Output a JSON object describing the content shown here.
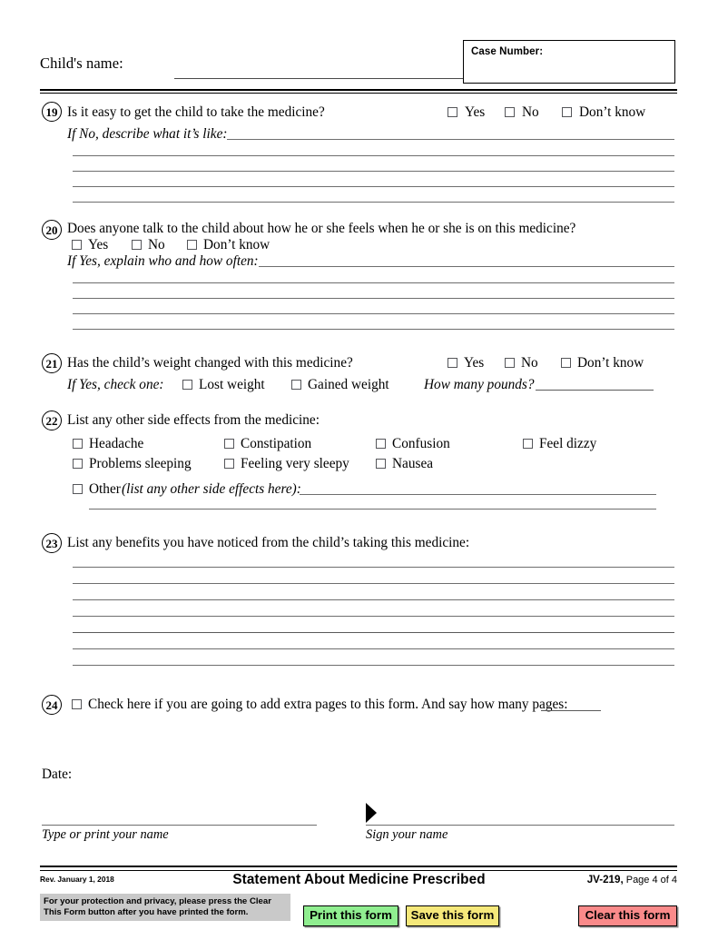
{
  "header": {
    "child_name_label": "Child's name:",
    "case_number_label": "Case Number:",
    "case_number_value": ""
  },
  "questions": [
    {
      "number": "19",
      "prompt": "Is it easy to get the child to take the medicine?",
      "options": [
        "Yes",
        "No",
        "Don’t know"
      ],
      "followup": "If No, describe what it’s like:",
      "write_lines": 4
    },
    {
      "number": "20",
      "prompt": "Does anyone talk to the child about how he or she feels when he or she is on this medicine?",
      "options": [
        "Yes",
        "No",
        "Don’t know"
      ],
      "followup": "If Yes, explain who and how often:",
      "write_lines": 4
    },
    {
      "number": "21",
      "prompt": "Has the child’s weight changed with this medicine?",
      "options": [
        "Yes",
        "No",
        "Don’t know"
      ],
      "followup": "If Yes, check one:",
      "weight_options": [
        "Lost weight",
        "Gained weight"
      ],
      "pounds_label": "How many pounds?",
      "pounds_value": ""
    },
    {
      "number": "22",
      "prompt": "List any other side effects from the medicine:",
      "side_effects_row1": [
        "Headache",
        "Constipation",
        "Confusion",
        "Feel dizzy"
      ],
      "side_effects_row2": [
        "Problems sleeping",
        "Feeling very sleepy",
        "Nausea"
      ],
      "other_label": "Other",
      "other_hint": "(list any other side effects here):",
      "other_value": "",
      "write_lines": 2
    },
    {
      "number": "23",
      "prompt": "List any benefits you have noticed from the child’s taking this medicine:",
      "write_lines": 7
    },
    {
      "number": "24",
      "prompt": "Check here if you are going to add extra pages to this form. And say how many pages:",
      "pages_value": ""
    }
  ],
  "signature": {
    "date_label": "Date:",
    "date_value": "",
    "print_name_caption": "Type or print your name",
    "sign_caption": "Sign your name",
    "sign_marker_icon": "arrow-right-marker-icon"
  },
  "footer": {
    "revision": "Rev. January 1, 2018",
    "form_title": "Statement About Medicine Prescribed",
    "form_code": "JV-219,",
    "page_info": " Page 4 of 4",
    "privacy_notice": "For your protection and privacy, please press the Clear This Form button after you have printed the form.",
    "buttons": [
      {
        "label": "Print this form",
        "color": "#90ee90"
      },
      {
        "label": "Save this form",
        "color": "#f5e87a"
      },
      {
        "label": "Clear this form",
        "color": "#fa8a8a"
      }
    ]
  }
}
